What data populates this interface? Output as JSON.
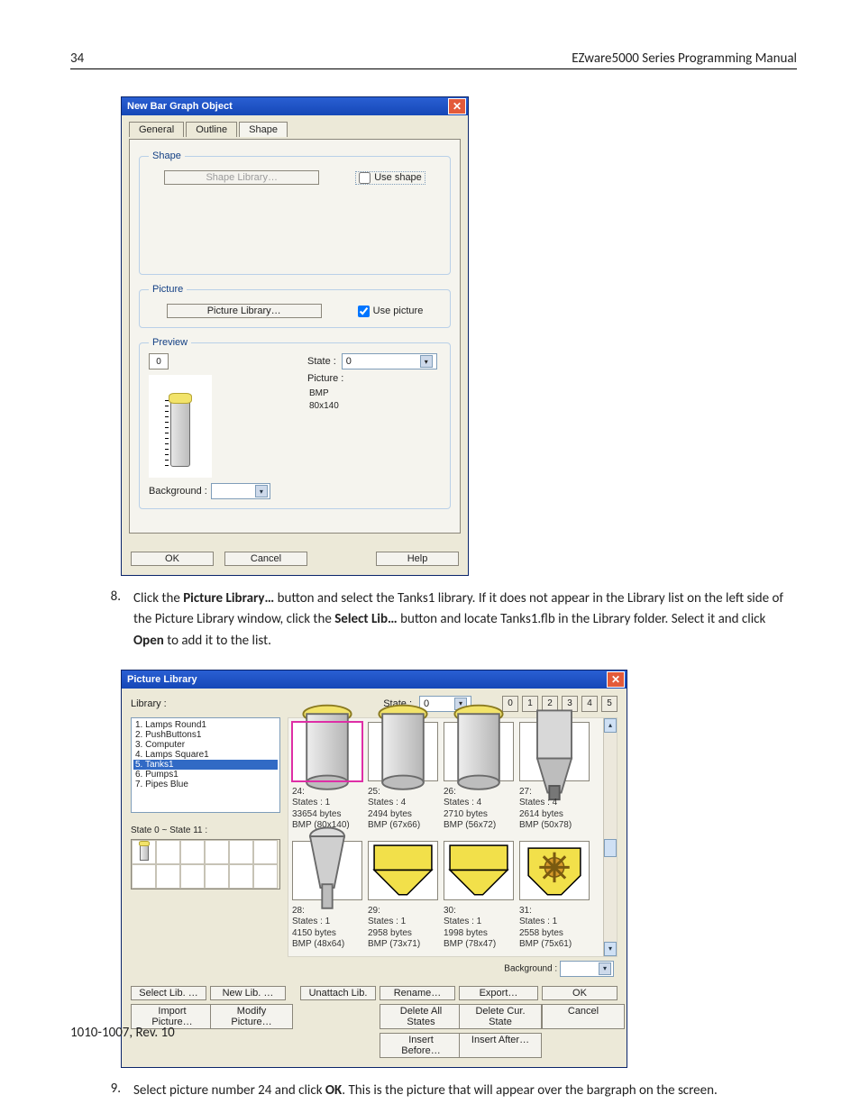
{
  "page": {
    "number": "34",
    "header_right": "EZware5000 Series Programming Manual",
    "footer": "1010-1007, Rev. 10"
  },
  "step8": {
    "num": "8.",
    "t1": "Click the ",
    "b1": "Picture Library…",
    "t2": " button and select the Tanks1 library. If it does not appear in the Library list on the left side of the Picture Library window, click the ",
    "b2": "Select Lib…",
    "t3": " button and locate Tanks1.flb in the Library folder. Select it and click ",
    "b3": "Open",
    "t4": " to add it to the list."
  },
  "step9": {
    "num": "9.",
    "t1": "Select picture number 24 and click ",
    "b1": "OK",
    "t2": ". This is the picture that will appear over the bargraph on the screen."
  },
  "dlg1": {
    "title": "New  Bar Graph Object",
    "tabs": {
      "general": "General",
      "outline": "Outline",
      "shape": "Shape"
    },
    "shape_group": "Shape",
    "shape_lib_btn": "Shape Library…",
    "use_shape": "Use shape",
    "picture_group": "Picture",
    "picture_lib_btn": "Picture Library…",
    "use_picture": "Use picture",
    "preview_group": "Preview",
    "state_zero": "0",
    "background_lbl": "Background :",
    "state_lbl": "State :",
    "state_val": "0",
    "picture_lbl": "Picture :",
    "picture_meta1": "BMP",
    "picture_meta2": "80x140",
    "ok": "OK",
    "cancel": "Cancel",
    "help": "Help"
  },
  "dlg2": {
    "title": "Picture Library",
    "library_lbl": "Library :",
    "state_lbl": "State :",
    "state_val": "0",
    "numtabs": [
      "0",
      "1",
      "2",
      "3",
      "4",
      "5"
    ],
    "list": [
      "1. Lamps Round1",
      "2. PushButtons1",
      "3. Computer",
      "4. Lamps Square1",
      "5. Tanks1",
      "6. Pumps1",
      "7. Pipes Blue"
    ],
    "list_selected_index": 4,
    "state_range": "State 0 ~ State 11 :",
    "thumbs": [
      {
        "id": "24:",
        "sel": true,
        "kind": "tank",
        "states": "States : 1",
        "bytes": "33654 bytes",
        "bmp": "BMP (80x140)"
      },
      {
        "id": "25:",
        "sel": false,
        "kind": "tank",
        "states": "States : 4",
        "bytes": "2494 bytes",
        "bmp": "BMP (67x66)"
      },
      {
        "id": "26:",
        "sel": false,
        "kind": "tank",
        "states": "States : 4",
        "bytes": "2710 bytes",
        "bmp": "BMP (56x72)"
      },
      {
        "id": "27:",
        "sel": false,
        "kind": "silo",
        "states": "States : 4",
        "bytes": "2614 bytes",
        "bmp": "BMP (50x78)"
      },
      {
        "id": "28:",
        "sel": false,
        "kind": "hopper",
        "states": "States : 1",
        "bytes": "4150 bytes",
        "bmp": "BMP (48x64)"
      },
      {
        "id": "29:",
        "sel": false,
        "kind": "funnelY",
        "states": "States : 1",
        "bytes": "2958 bytes",
        "bmp": "BMP (73x71)"
      },
      {
        "id": "30:",
        "sel": false,
        "kind": "funnelY",
        "states": "States : 1",
        "bytes": "1998 bytes",
        "bmp": "BMP (78x47)"
      },
      {
        "id": "31:",
        "sel": false,
        "kind": "gearY",
        "states": "States : 1",
        "bytes": "2558 bytes",
        "bmp": "BMP (75x61)"
      }
    ],
    "background_lbl": "Background :",
    "buttons": {
      "select_lib": "Select Lib. …",
      "new_lib": "New Lib. …",
      "unattach": "Unattach Lib.",
      "rename": "Rename…",
      "export": "Export…",
      "ok": "OK",
      "import_pic": "Import Picture…",
      "modify_pic": "Modify Picture…",
      "del_all": "Delete All States",
      "del_cur": "Delete Cur. State",
      "cancel": "Cancel",
      "ins_before": "Insert Before…",
      "ins_after": "Insert After…"
    }
  }
}
